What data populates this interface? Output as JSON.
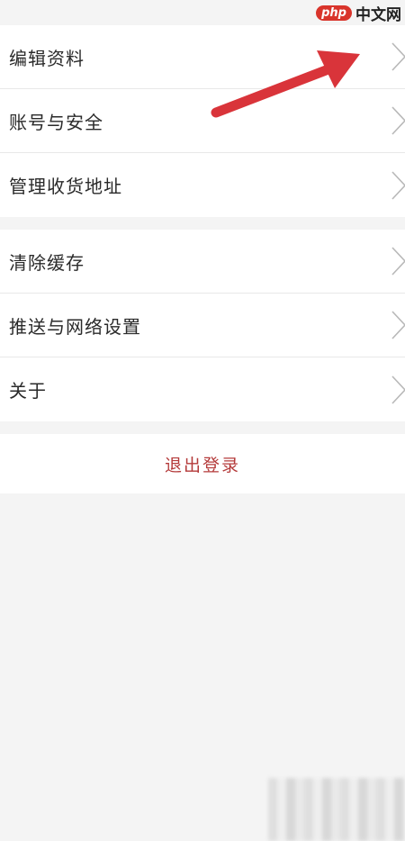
{
  "settings": {
    "group1": [
      {
        "label": "编辑资料"
      },
      {
        "label": "账号与安全"
      },
      {
        "label": "管理收货地址"
      }
    ],
    "group2": [
      {
        "label": "清除缓存"
      },
      {
        "label": "推送与网络设置"
      },
      {
        "label": "关于"
      }
    ],
    "logout_label": "退出登录"
  },
  "watermark": {
    "logo_text": "php",
    "site_text": "中文网"
  },
  "colors": {
    "background": "#f4f4f4",
    "row_background": "#ffffff",
    "logout_text": "#b43a3a",
    "annotation_arrow": "#d9343a",
    "chevron": "#b8b8b8"
  },
  "icons": {
    "row_chevron": "chevron-right-icon",
    "annotation": "red-arrow-icon"
  }
}
